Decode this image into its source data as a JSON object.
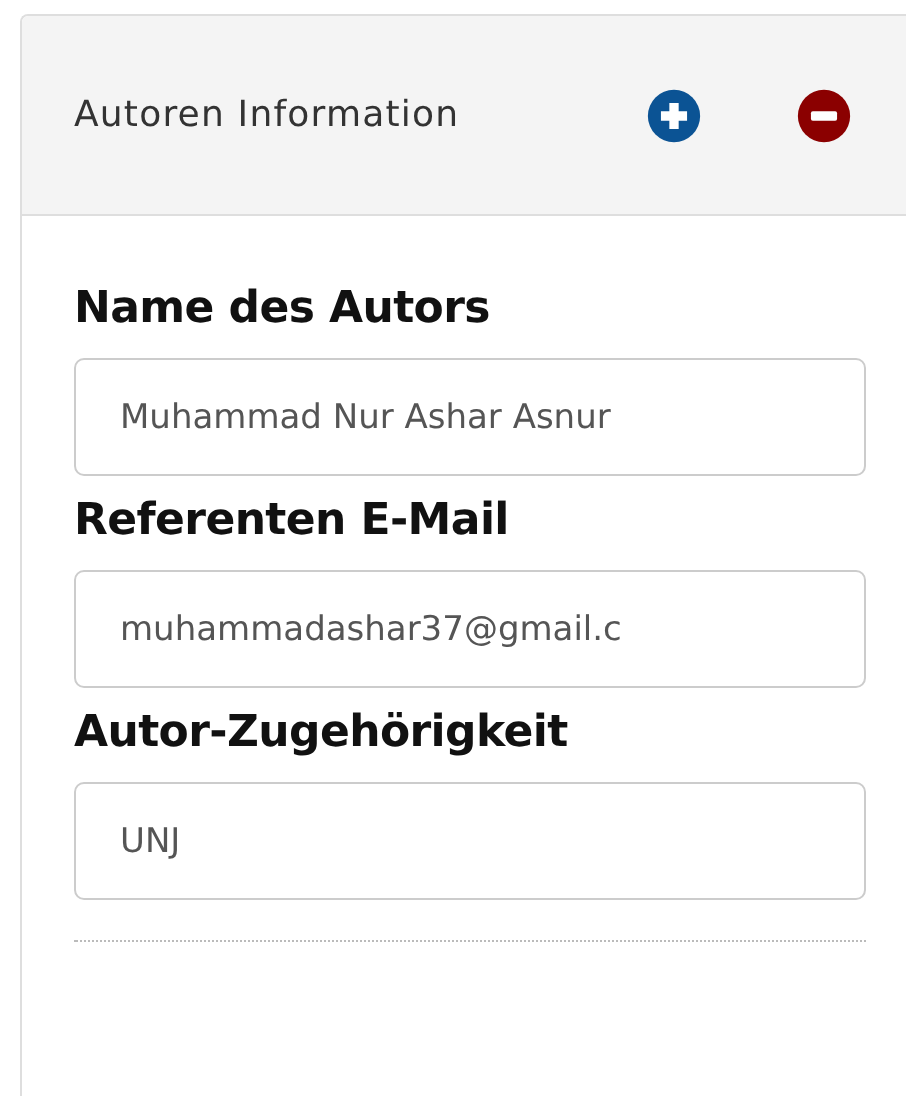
{
  "panel": {
    "title": "Autoren Information",
    "actions": [
      {
        "kind": "add",
        "color": "#0b5394"
      },
      {
        "kind": "remove",
        "color": "#8b0000"
      }
    ]
  },
  "fields": [
    {
      "label": "Name des Autors",
      "value": "Muhammad Nur Ashar Asnur"
    },
    {
      "label": "Referenten E-Mail",
      "value": "muhammadashar37@gmail.c"
    },
    {
      "label": "Autor-Zugehörigkeit",
      "value": "UNJ"
    }
  ]
}
